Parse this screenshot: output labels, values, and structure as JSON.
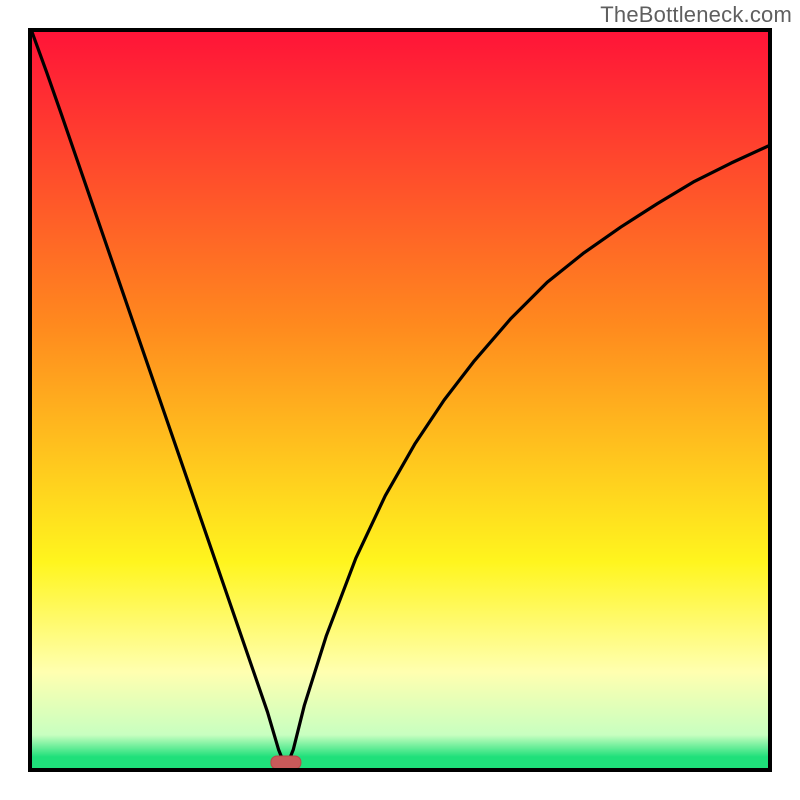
{
  "watermark": {
    "text": "TheBottleneck.com"
  },
  "colors": {
    "gradient_top": "#ff1438",
    "gradient_mid1": "#ff8a1e",
    "gradient_mid2": "#fff51e",
    "gradient_pale": "#ffffb0",
    "gradient_green": "#1fe07a",
    "frame": "#000000",
    "curve": "#000000",
    "marker_fill": "#c85a5a",
    "marker_stroke": "#b84848"
  },
  "chart_data": {
    "type": "line",
    "title": "",
    "xlabel": "",
    "ylabel": "",
    "x": [
      0.0,
      0.02,
      0.04,
      0.06,
      0.08,
      0.1,
      0.12,
      0.14,
      0.16,
      0.18,
      0.2,
      0.22,
      0.24,
      0.26,
      0.28,
      0.3,
      0.32,
      0.335,
      0.345,
      0.355,
      0.37,
      0.4,
      0.44,
      0.48,
      0.52,
      0.56,
      0.6,
      0.65,
      0.7,
      0.75,
      0.8,
      0.85,
      0.9,
      0.95,
      1.0
    ],
    "values": [
      1.0,
      0.945,
      0.888,
      0.83,
      0.772,
      0.714,
      0.656,
      0.598,
      0.54,
      0.482,
      0.424,
      0.366,
      0.308,
      0.25,
      0.192,
      0.134,
      0.076,
      0.025,
      0.0,
      0.025,
      0.085,
      0.18,
      0.285,
      0.37,
      0.44,
      0.5,
      0.552,
      0.61,
      0.66,
      0.7,
      0.735,
      0.767,
      0.797,
      0.822,
      0.845
    ],
    "xlim": [
      0,
      1
    ],
    "ylim": [
      0,
      1
    ],
    "marker": {
      "x": 0.345,
      "y": 0.0
    },
    "gradient_stops": [
      {
        "offset": 0.0,
        "color": "#ff1438"
      },
      {
        "offset": 0.4,
        "color": "#ff8a1e"
      },
      {
        "offset": 0.72,
        "color": "#fff51e"
      },
      {
        "offset": 0.87,
        "color": "#ffffb0"
      },
      {
        "offset": 0.955,
        "color": "#c8ffc0"
      },
      {
        "offset": 0.985,
        "color": "#1fe07a"
      },
      {
        "offset": 1.0,
        "color": "#1fe07a"
      }
    ]
  }
}
